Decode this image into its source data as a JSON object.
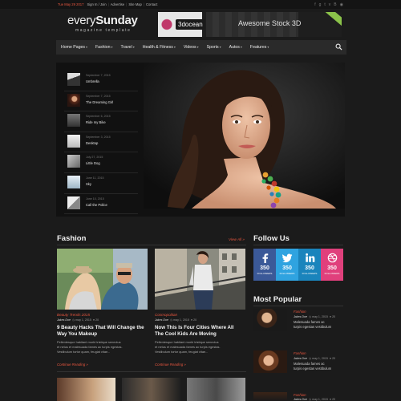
{
  "topbar": {
    "date": "Tue May 29 2017",
    "links": [
      "Sign In / Join",
      "Advertise",
      "Site Map",
      "Contact"
    ],
    "social_icons": [
      "facebook-icon",
      "googleplus-icon",
      "twitter-icon",
      "vimeo-icon",
      "behance-icon",
      "rss-icon"
    ]
  },
  "logo": {
    "word_light": "every",
    "word_bold": "Sunday",
    "tagline": "magazine template"
  },
  "banner": {
    "brand": "3docean",
    "text": "Awesome Stock 3D"
  },
  "nav": {
    "items": [
      {
        "label": "Home Pages",
        "caret": "▾"
      },
      {
        "label": "Fashion",
        "caret": "▾"
      },
      {
        "label": "Travel",
        "caret": "▾"
      },
      {
        "label": "Health & Fitness",
        "caret": "▾"
      },
      {
        "label": "Videos",
        "caret": "▾"
      },
      {
        "label": "Sports",
        "caret": "▾"
      },
      {
        "label": "Autos",
        "caret": "▾"
      },
      {
        "label": "Features",
        "caret": "▾"
      }
    ]
  },
  "hero": {
    "list": [
      {
        "date": "September 7, 2015",
        "title": "Umbrella"
      },
      {
        "date": "September 7, 2015",
        "title": "The Dreaming Girl"
      },
      {
        "date": "September 6, 2015",
        "title": "Ride my Bike"
      },
      {
        "date": "September 3, 2015",
        "title": "Desktop"
      },
      {
        "date": "July 27, 2015",
        "title": "Little Dog"
      },
      {
        "date": "June 11, 2015",
        "title": "Sky"
      },
      {
        "date": "June 10, 2015",
        "title": "Call the Police"
      }
    ]
  },
  "fashion": {
    "title": "Fashion",
    "view_all": "View All »",
    "cards": [
      {
        "category": "Beauty Trends 2015",
        "author": "Jakes Doe",
        "date": "may 1, 2015",
        "comments": "20",
        "title_line1": "9 Beauty Hacks That Will Change the",
        "title_line2": "Way You Makeup",
        "excerpt_line1": "Pellentesque habitant morbi tristique senectus",
        "excerpt_line2": "et netus et malesuada fames ac turpis egestas.",
        "excerpt_line3": "Vestibulum tortor quam, feugiat vitae...",
        "continue": "Continue Reading »"
      },
      {
        "category": "Cosmopolitan",
        "author": "Jakes Doe",
        "date": "may 1, 2015",
        "comments": "20",
        "title_line1": "Now This Is Four Cities Where All",
        "title_line2": "The Cool Kids Are Moving",
        "excerpt_line1": "Pellentesque habitant morbi tristique senectus",
        "excerpt_line2": "et netus et malesuada fames ac turpis egestas.",
        "excerpt_line3": "Vestibulum tortor quam, feugiat vitae...",
        "continue": "Continue Reading »"
      }
    ]
  },
  "follow": {
    "title": "Follow Us",
    "tiles": [
      {
        "count": "350",
        "label": "FOLLOWERS",
        "color": "#3b5998",
        "icon": "facebook-icon"
      },
      {
        "count": "350",
        "label": "FOLLOWERS",
        "color": "#2fa3e0",
        "icon": "twitter-icon"
      },
      {
        "count": "350",
        "label": "FOLLOWERS",
        "color": "#1a84bc",
        "icon": "linkedin-icon"
      },
      {
        "count": "350",
        "label": "FOLLOWERS",
        "color": "#e0407c",
        "icon": "dribbble-icon"
      }
    ]
  },
  "popular": {
    "title": "Most Popular",
    "items": [
      {
        "category": "Fashion",
        "author": "Jakes Doe",
        "date": "may 1, 2015",
        "comments": "20",
        "line1": "Malesuada fames ac",
        "line2": "turpis egestas vestibulum"
      },
      {
        "category": "Fashion",
        "author": "Jakes Doe",
        "date": "may 1, 2015",
        "comments": "20",
        "line1": "Malesuada fames ac",
        "line2": "turpis egestas vestibulum"
      },
      {
        "category": "Fashion",
        "author": "Jakes Doe",
        "date": "may 1, 2015",
        "comments": "20",
        "line1": "",
        "line2": ""
      }
    ]
  },
  "colors": {
    "accent": "#e8563f",
    "background": "#1b1b1b",
    "nav": "#2a2a2a"
  }
}
